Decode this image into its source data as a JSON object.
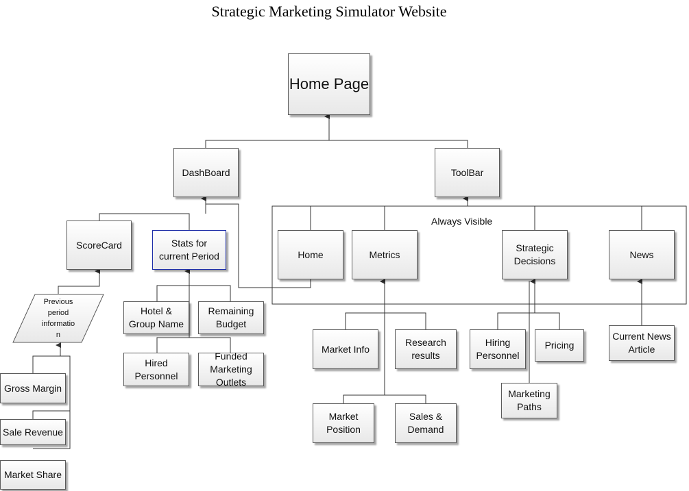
{
  "diagram": {
    "title": "Strategic Marketing Simulator Website",
    "group_label": "Always Visible",
    "nodes": {
      "home_page": "Home Page",
      "dashboard": "DashBoard",
      "toolbar": "ToolBar",
      "scorecard": "ScoreCard",
      "stats": "Stats for\ncurrent Period",
      "previous": "Previous\nperiod\ninformatio\nn",
      "gross_margin": "Gross Margin",
      "sale_revenue": "Sale Revenue",
      "market_share": "Market Share",
      "hotel": "Hotel &\nGroup Name",
      "remaining_budget": "Remaining\nBudget",
      "hired_personnel": "Hired\nPersonnel",
      "funded_outlets": "Funded\nMarketing\nOutlets",
      "home": "Home",
      "metrics": "Metrics",
      "strategic": "Strategic\nDecisions",
      "news": "News",
      "market_info": "Market Info",
      "research": "Research\nresults",
      "market_position": "Market\nPosition",
      "sales_demand": "Sales &\nDemand",
      "hiring": "Hiring\nPersonnel",
      "pricing": "Pricing",
      "marketing_paths": "Marketing\nPaths",
      "current_news": "Current News\nArticle"
    }
  }
}
